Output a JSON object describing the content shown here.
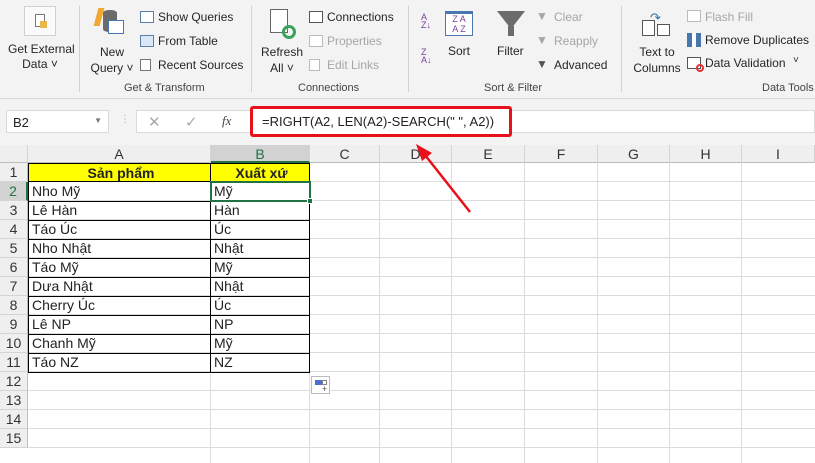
{
  "ribbon": {
    "get_external_data": [
      "Get External",
      "Data ˅"
    ],
    "new_query": [
      "New",
      "Query ˅"
    ],
    "show_queries": "Show Queries",
    "from_table": "From Table",
    "recent_sources": "Recent Sources",
    "group_get_transform": "Get & Transform",
    "refresh_all": [
      "Refresh",
      "All ˅"
    ],
    "connections": "Connections",
    "properties": "Properties",
    "edit_links": "Edit Links",
    "group_connections": "Connections",
    "sort": "Sort",
    "filter": "Filter",
    "clear": "Clear",
    "reapply": "Reapply",
    "advanced": "Advanced",
    "group_sort_filter": "Sort & Filter",
    "text_to_columns": [
      "Text to",
      "Columns"
    ],
    "flash_fill": "Flash Fill",
    "remove_duplicates": "Remove Duplicates",
    "data_validation": "Data Validation",
    "group_data_tools": "Data Tools"
  },
  "formula_bar": {
    "name_box": "B2",
    "formula": "=RIGHT(A2, LEN(A2)-SEARCH(\" \", A2))"
  },
  "columns": [
    "A",
    "B",
    "C",
    "D",
    "E",
    "F",
    "G",
    "H",
    "I"
  ],
  "rows": [
    "1",
    "2",
    "3",
    "4",
    "5",
    "6",
    "7",
    "8",
    "9",
    "10",
    "11",
    "12",
    "13",
    "14",
    "15"
  ],
  "headers": {
    "a": "Sản phẩm",
    "b": "Xuất xứ"
  },
  "data": [
    [
      "Nho Mỹ",
      "Mỹ"
    ],
    [
      "Lê Hàn",
      "Hàn"
    ],
    [
      "Táo Úc",
      "Úc"
    ],
    [
      "Nho Nhật",
      "Nhật"
    ],
    [
      "Táo Mỹ",
      "Mỹ"
    ],
    [
      "Dưa Nhật",
      "Nhật"
    ],
    [
      "Cherry Úc",
      "Úc"
    ],
    [
      "Lê NP",
      "NP"
    ],
    [
      "Chanh Mỹ",
      "Mỹ"
    ],
    [
      "Táo NZ",
      "NZ"
    ]
  ],
  "colors": {
    "header_fill": "#ffff00",
    "selection": "#217346",
    "annotation": "#e8101a"
  }
}
